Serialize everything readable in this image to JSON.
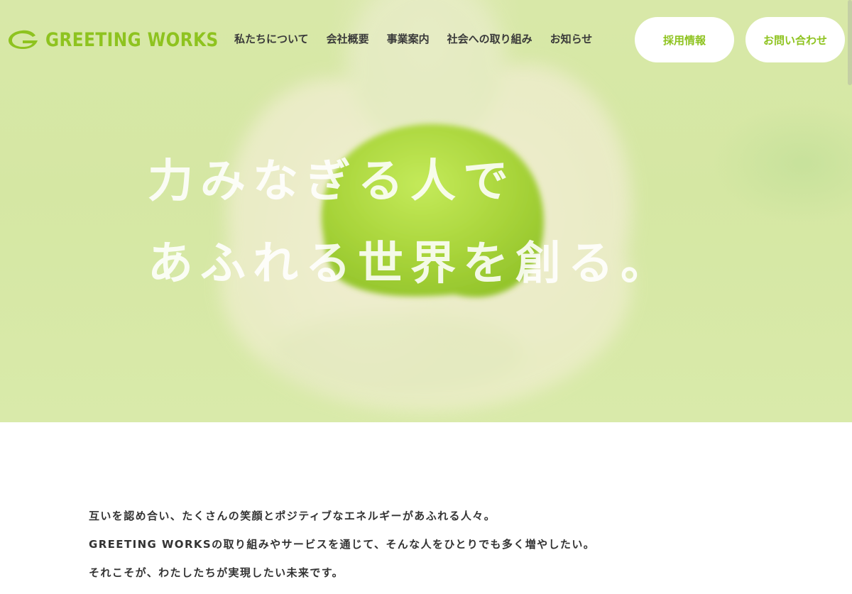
{
  "header": {
    "logo_text": "GREETING WORKS",
    "logo_icon": "greeting-works-g-mark"
  },
  "nav": {
    "items": [
      {
        "label": "私たちについて"
      },
      {
        "label": "会社概要"
      },
      {
        "label": "事業案内"
      },
      {
        "label": "社会への取り組み"
      },
      {
        "label": "お知らせ"
      }
    ],
    "recruit_label": "採用情報",
    "contact_label": "お問い合わせ"
  },
  "hero": {
    "headline_line1": "力みなぎる人で",
    "headline_line2": "あふれる世界を創る。"
  },
  "intro": {
    "lines": [
      "互いを認め合い、たくさんの笑顔とポジティブなエネルギーがあふれる人々。",
      "GREETING WORKSの取り組みやサービスを通じて、そんな人をひとりでも多く増やしたい。",
      "それこそが、わたしたちが実現したい未来です。"
    ]
  },
  "colors": {
    "brand_green": "#8ec31f",
    "hero_bg": "#d6e8a6",
    "nav_text": "#3a3a3a",
    "body_text": "#333333"
  }
}
